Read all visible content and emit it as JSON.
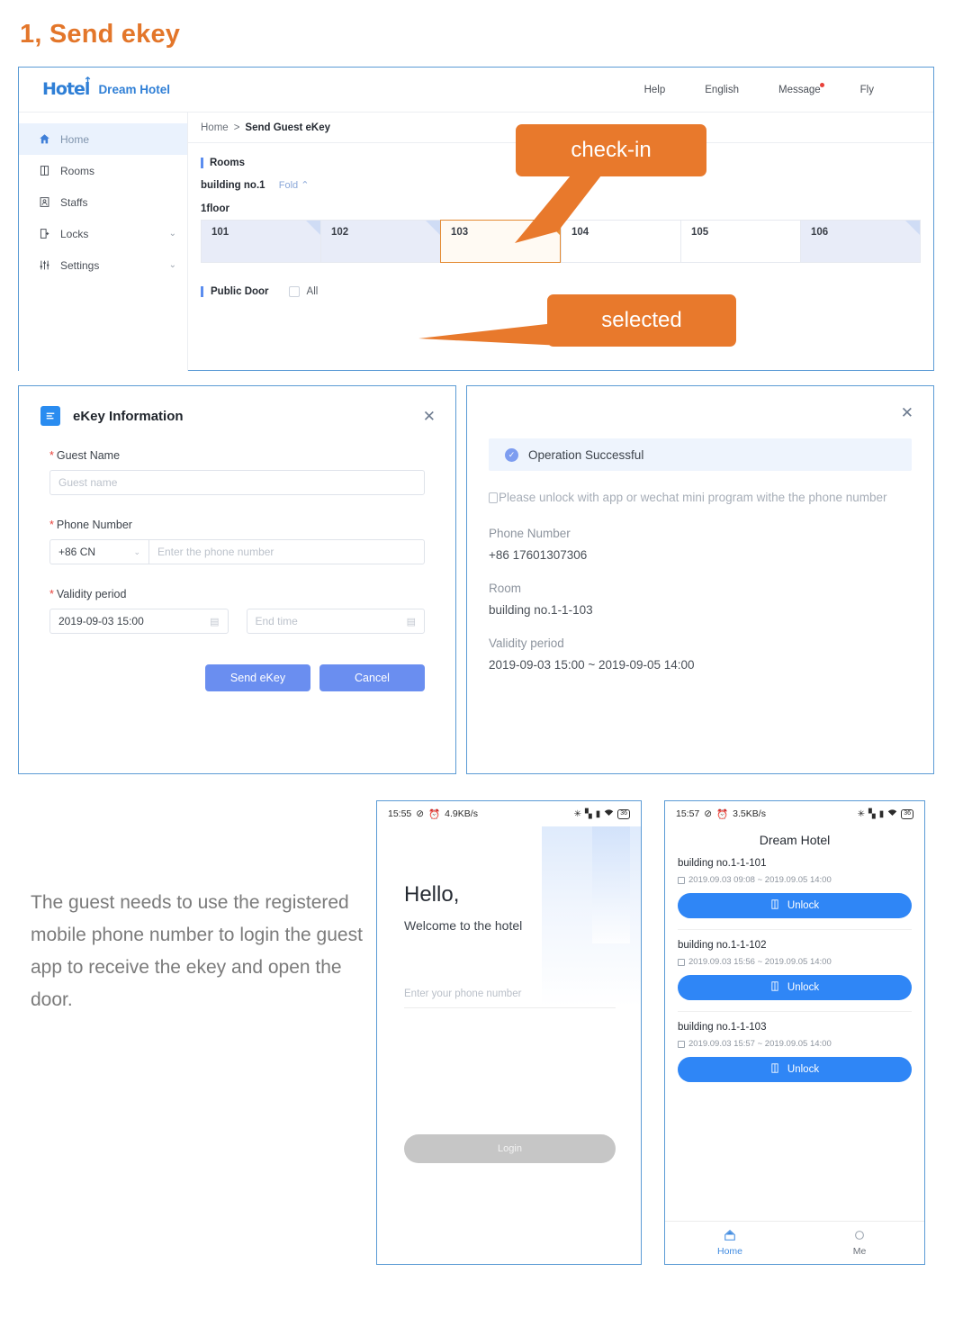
{
  "section": {
    "title": "1, Send ekey"
  },
  "webapp": {
    "logo_mark": "Hotel",
    "brand": "Dream Hotel",
    "nav": [
      {
        "label": "Help",
        "badge": false
      },
      {
        "label": "English",
        "badge": false
      },
      {
        "label": "Message",
        "badge": true
      },
      {
        "label": "Fly",
        "badge": false
      }
    ],
    "sidebar": [
      {
        "label": "Home",
        "icon": "home-icon",
        "active": true,
        "chevron": ""
      },
      {
        "label": "Rooms",
        "icon": "door-icon",
        "active": false,
        "chevron": ""
      },
      {
        "label": "Staffs",
        "icon": "staff-icon",
        "active": false,
        "chevron": ""
      },
      {
        "label": "Locks",
        "icon": "lock-icon",
        "active": false,
        "chevron": "⌄"
      },
      {
        "label": "Settings",
        "icon": "sliders-icon",
        "active": false,
        "chevron": "⌄"
      }
    ],
    "breadcrumb": {
      "root": "Home",
      "sep": ">",
      "current": "Send Guest eKey"
    },
    "rooms_heading": "Rooms",
    "building": "building no.1",
    "fold": "Fold ⌃",
    "floor": "1floor",
    "rooms": [
      {
        "no": "101",
        "state": "occupied"
      },
      {
        "no": "102",
        "state": "occupied"
      },
      {
        "no": "103",
        "state": "selected"
      },
      {
        "no": "104",
        "state": "free"
      },
      {
        "no": "105",
        "state": "free"
      },
      {
        "no": "106",
        "state": "occupied"
      }
    ],
    "public_door_label": "Public Door",
    "public_door_all": "All"
  },
  "callouts": {
    "checkin": "check-in",
    "selected": "selected",
    "color": "#e8792c"
  },
  "ekey_dialog": {
    "title": "eKey Information",
    "close": "✕",
    "guest_name_label": "Guest Name",
    "guest_name_placeholder": "Guest name",
    "phone_label": "Phone Number",
    "country_code": "+86 CN",
    "phone_placeholder": "Enter the phone number",
    "validity_label": "Validity period",
    "start_value": "2019-09-03 15:00",
    "end_placeholder": "End time",
    "send_label": "Send eKey",
    "cancel_label": "Cancel",
    "button_color": "#6a8ef0"
  },
  "success_dialog": {
    "close": "✕",
    "banner": "Operation Successful",
    "note": "Please unlock with app or wechat mini program withe the phone number",
    "phone_key": "Phone Number",
    "phone_value": "+86 17601307306",
    "room_key": "Room",
    "room_value": "building no.1-1-103",
    "validity_key": "Validity period",
    "validity_value": "2019-09-03 15:00  ~  2019-09-05 14:00"
  },
  "paragraph": "The guest needs to use the registered mobile phone number to login the guest app to receive the ekey and open the door.",
  "phone_login": {
    "status": {
      "time": "15:55",
      "mute": "⊘",
      "alarm": "⏰",
      "speed": "4.9KB/s",
      "bluetooth": "✳",
      "signal1": "▚",
      "signal2": "▮",
      "wifi": "⌃",
      "battery": "36"
    },
    "hello": "Hello,",
    "welcome": "Welcome to the hotel",
    "phone_placeholder": "Enter your phone number",
    "login_label": "Login"
  },
  "phone_list": {
    "status": {
      "time": "15:57",
      "mute": "⊘",
      "alarm": "⏰",
      "speed": "3.5KB/s",
      "bluetooth": "✳",
      "signal1": "▚",
      "signal2": "▮",
      "wifi": "⌃",
      "battery": "36"
    },
    "title": "Dream Hotel",
    "items": [
      {
        "room": "building no.1-1-101",
        "period": "2019.09.03 09:08 ~ 2019.09.05 14:00",
        "action": "Unlock"
      },
      {
        "room": "building no.1-1-102",
        "period": "2019.09.03 15:56 ~ 2019.09.05 14:00",
        "action": "Unlock"
      },
      {
        "room": "building no.1-1-103",
        "period": "2019.09.03 15:57 ~ 2019.09.05 14:00",
        "action": "Unlock"
      }
    ],
    "tabs": [
      {
        "label": "Home",
        "icon": "home-icon",
        "active": true
      },
      {
        "label": "Me",
        "icon": "person-icon",
        "active": false
      }
    ]
  }
}
